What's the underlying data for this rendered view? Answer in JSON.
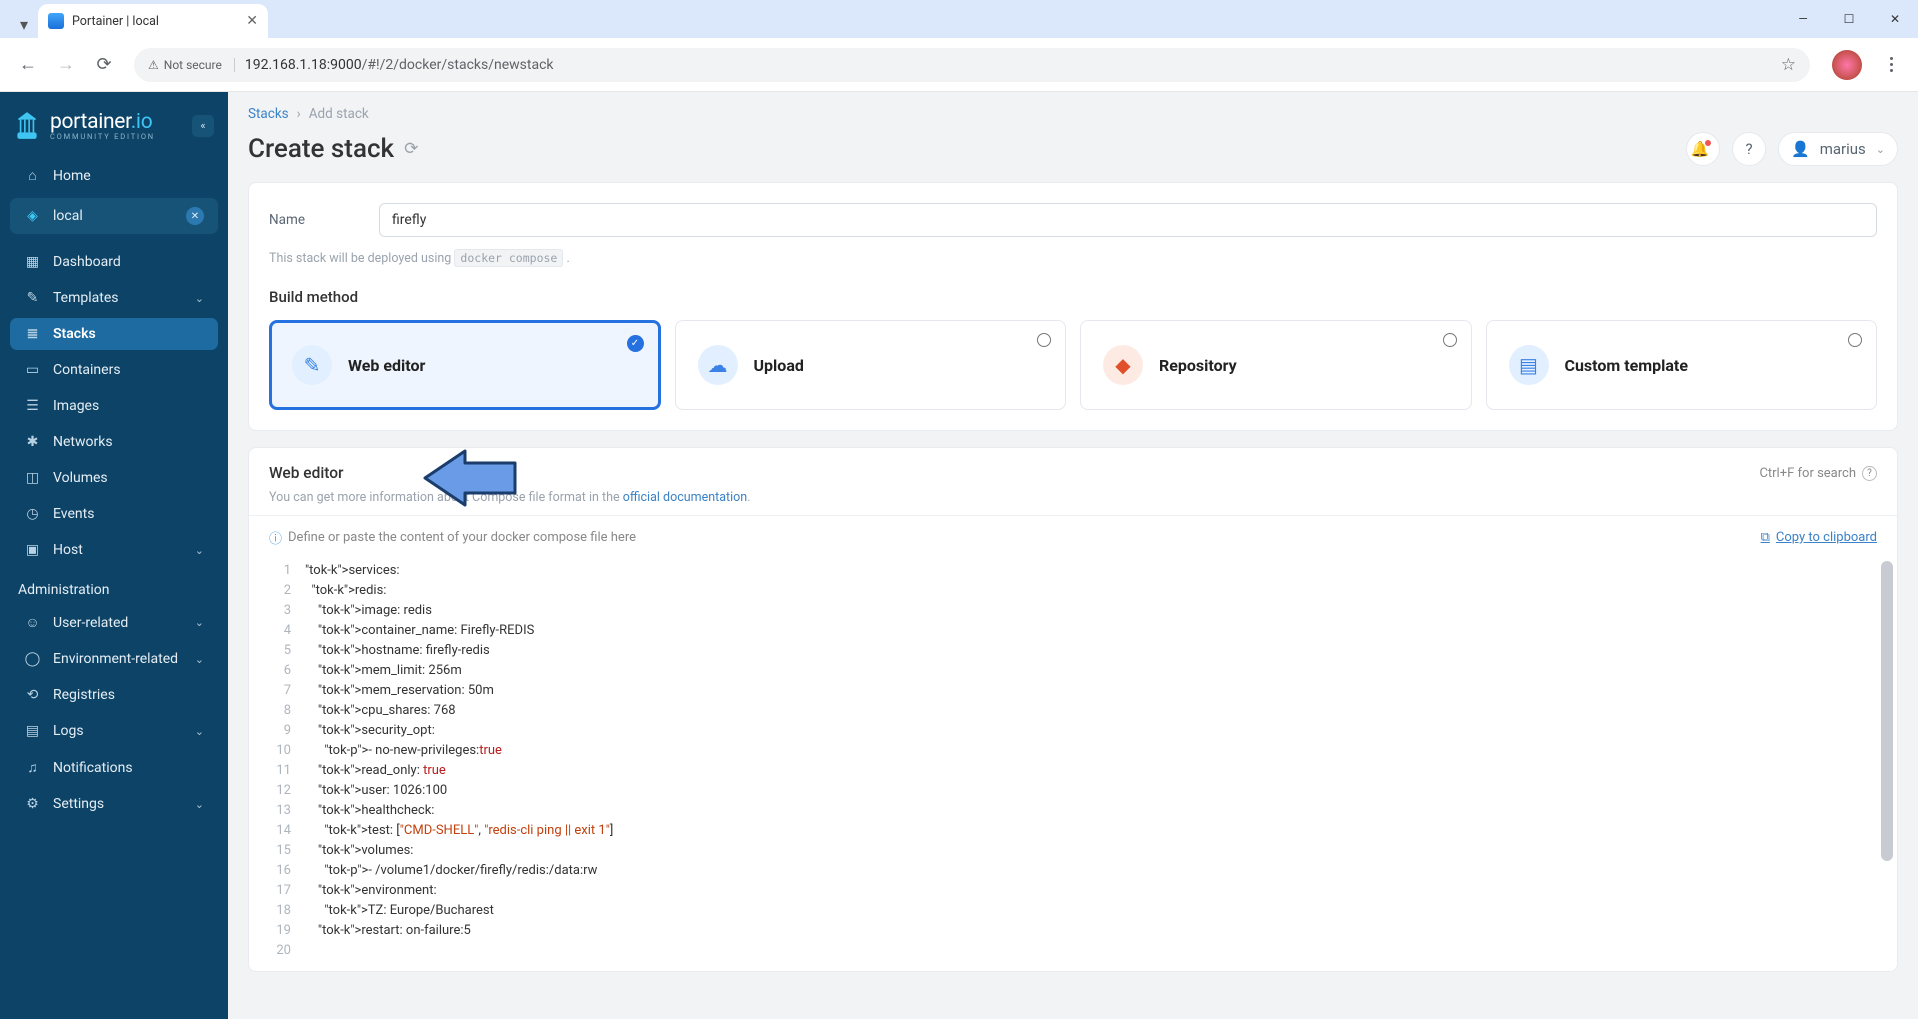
{
  "browser": {
    "tab_title": "Portainer | local",
    "url_host": "192.168.1.18:9000",
    "url_path": "/#!/2/docker/stacks/newstack",
    "not_secure": "Not secure"
  },
  "sidebar": {
    "brand": "portainer",
    "brand_tld": ".io",
    "brand_sub": "COMMUNITY EDITION",
    "home": "Home",
    "env_name": "local",
    "items": [
      "Dashboard",
      "Templates",
      "Stacks",
      "Containers",
      "Images",
      "Networks",
      "Volumes",
      "Events",
      "Host"
    ],
    "admin_header": "Administration",
    "admin_items": [
      "User-related",
      "Environment-related",
      "Registries",
      "Logs",
      "Notifications",
      "Settings"
    ]
  },
  "header": {
    "bc_root": "Stacks",
    "bc_current": "Add stack",
    "title": "Create stack",
    "username": "marius"
  },
  "form": {
    "name_label": "Name",
    "name_value": "firefly",
    "deploy_note_pre": "This stack will be deployed using ",
    "deploy_note_code": "docker compose",
    "build_method_label": "Build method",
    "methods": [
      "Web editor",
      "Upload",
      "Repository",
      "Custom template"
    ]
  },
  "editor": {
    "title": "Web editor",
    "search_hint": "Ctrl+F for search",
    "desc_pre": "You can get more information about Compose file format in the ",
    "desc_link": "official documentation",
    "placeholder_hint": "Define or paste the content of your docker compose file here",
    "copy_label": "Copy to clipboard",
    "lines": [
      "services:",
      "  redis:",
      "    image: redis",
      "    container_name: Firefly-REDIS",
      "    hostname: firefly-redis",
      "    mem_limit: 256m",
      "    mem_reservation: 50m",
      "    cpu_shares: 768",
      "    security_opt:",
      "      - no-new-privileges:true",
      "    read_only: true",
      "    user: 1026:100",
      "    healthcheck:",
      "      test: [\"CMD-SHELL\", \"redis-cli ping || exit 1\"]",
      "    volumes:",
      "      - /volume1/docker/firefly/redis:/data:rw",
      "    environment:",
      "      TZ: Europe/Bucharest",
      "    restart: on-failure:5",
      ""
    ]
  },
  "chart_data": null
}
